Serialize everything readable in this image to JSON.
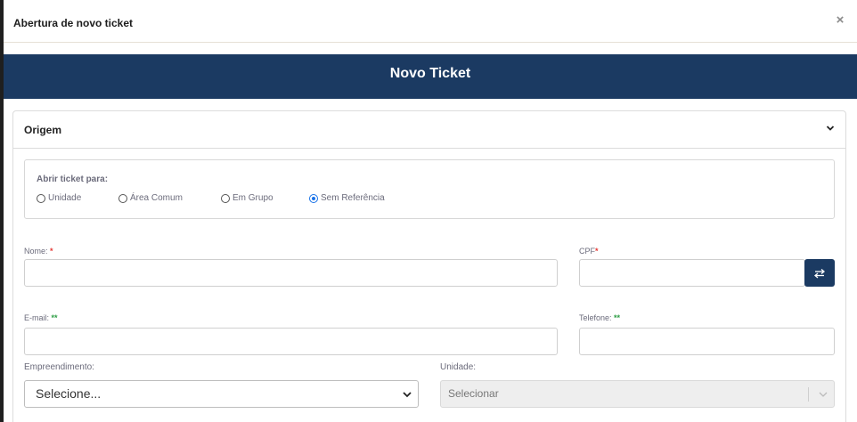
{
  "modal": {
    "title": "Abertura de novo ticket",
    "close_icon": "×"
  },
  "banner": {
    "title": "Novo Ticket"
  },
  "origem": {
    "title": "Origem",
    "reference": {
      "label": "Abrir ticket para:",
      "options": [
        {
          "label": "Unidade",
          "checked": false
        },
        {
          "label": "Área Comum",
          "checked": false
        },
        {
          "label": "Em Grupo",
          "checked": false
        },
        {
          "label": "Sem Referência",
          "checked": true
        }
      ]
    },
    "fields": {
      "nome": {
        "label": "Nome:",
        "required_mark": "*",
        "value": ""
      },
      "cpf": {
        "label": "CPF",
        "required_mark": "*",
        "value": ""
      },
      "email": {
        "label": "E-mail:",
        "required_mark": "**",
        "value": ""
      },
      "telefone": {
        "label": "Telefone:",
        "required_mark": "**",
        "value": ""
      },
      "empreendimento": {
        "label": "Empreendimento:",
        "value": "Selecione..."
      },
      "unidade": {
        "label": "Unidade:",
        "value": "Selecionar"
      }
    }
  },
  "colors": {
    "brand_navy": "#1b3a62",
    "required_red": "#e53935",
    "required_green": "#2e9e45",
    "radio_selected": "#1a73e8"
  }
}
